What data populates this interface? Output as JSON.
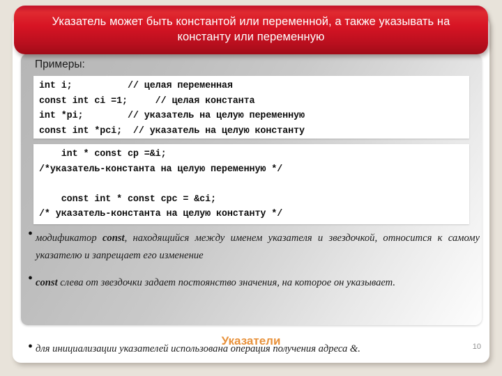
{
  "slide": {
    "title": "Указатель может быть константой или переменной, а также указывать на константу или переменную",
    "examples_label": "Примеры:",
    "footer_title": "Указатели",
    "slide_number": "10",
    "accent_red": "#d71424",
    "accent_orange": "#e8913a"
  },
  "code_block_1": {
    "lines": [
      "int i;          // целая переменная",
      "const int ci =1;     // целая константа",
      "int *pi;        // указатель на целую переменную",
      "const int *pci;  // указатель на целую константу"
    ]
  },
  "code_block_2": {
    "lines": [
      "    int * const cp =&i;",
      "/*указатель-константа на целую переменную */",
      "",
      "    const int * const cpc = &ci;",
      "/* указатель-константа на целую константу */"
    ]
  },
  "bullets": [
    {
      "prefix": "модификатор ",
      "bold": "const",
      "suffix": ", находящийся между именем указателя и звездочкой, относится к самому указателю и запрещает его изменение"
    },
    {
      "prefix": "",
      "bold": "const",
      "suffix": " слева от звездочки задает постоянство значения, на которое он указывает."
    }
  ],
  "footer_bullet": {
    "prefix": "",
    "bold": "",
    "suffix": "для инициализации указателей использована операция получения адреса &."
  }
}
